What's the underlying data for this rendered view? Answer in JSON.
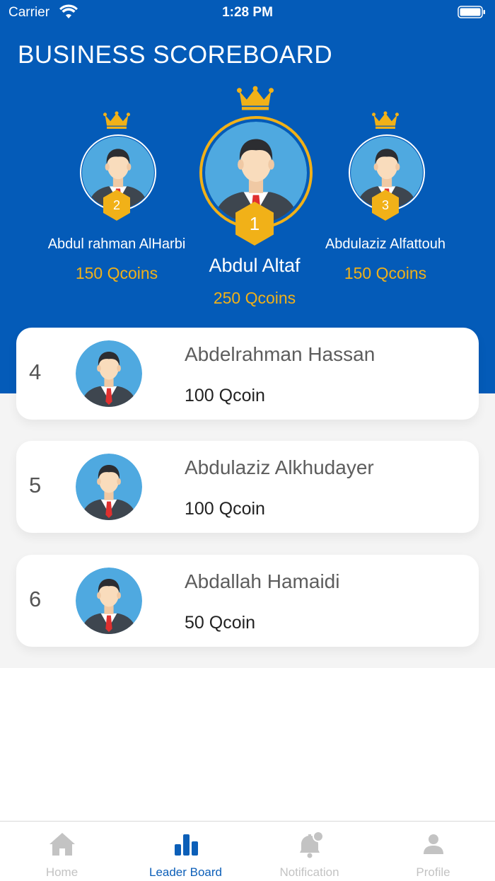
{
  "status": {
    "carrier": "Carrier",
    "time": "1:28 PM"
  },
  "header": {
    "title": "BUSINESS SCOREBOARD"
  },
  "podium": [
    {
      "rank": "1",
      "name": "Abdul Altaf",
      "score": "250 Qcoins"
    },
    {
      "rank": "2",
      "name": "Abdul rahman AlHarbi",
      "score": "150 Qcoins"
    },
    {
      "rank": "3",
      "name": "Abdulaziz Alfattouh",
      "score": "150 Qcoins"
    }
  ],
  "leaderboard": [
    {
      "rank": "4",
      "name": "Abdelrahman Hassan",
      "score": "100 Qcoin"
    },
    {
      "rank": "5",
      "name": "Abdulaziz Alkhudayer",
      "score": "100 Qcoin"
    },
    {
      "rank": "6",
      "name": "Abdallah Hamaidi",
      "score": "50 Qcoin"
    }
  ],
  "tabs": [
    {
      "label": "Home",
      "icon": "home-icon",
      "active": false
    },
    {
      "label": "Leader Board",
      "icon": "leaderboard-icon",
      "active": true
    },
    {
      "label": "Notification",
      "icon": "bell-icon",
      "active": false
    },
    {
      "label": "Profile",
      "icon": "person-icon",
      "active": false
    }
  ],
  "colors": {
    "header_blue": "#045bb8",
    "gold": "#f1b118",
    "tab_active": "#0c5fb8",
    "tab_inactive": "#c3c3c3",
    "avatar_bg": "#4fa9e0"
  }
}
